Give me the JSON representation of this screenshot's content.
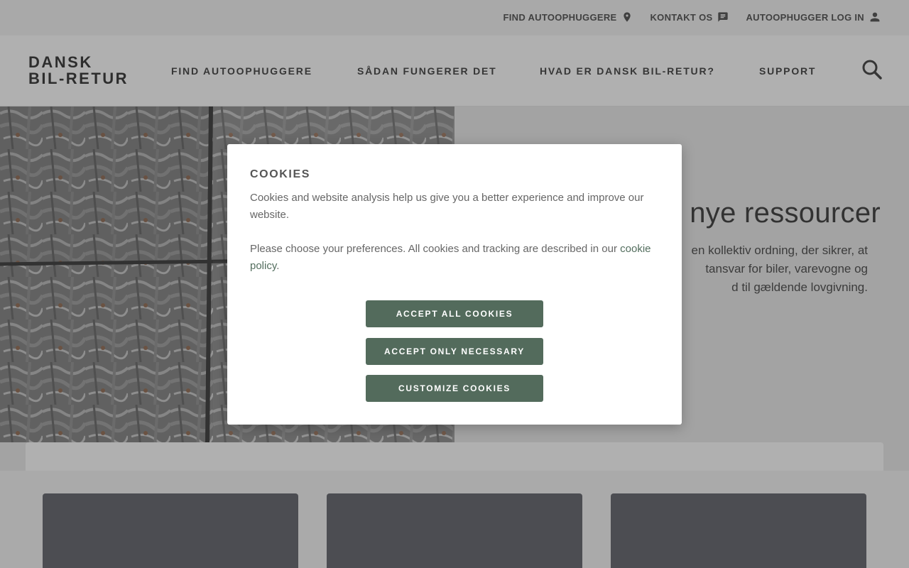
{
  "utility_nav": {
    "find_label": "FIND AUTOOPHUGGERE",
    "contact_label": "KONTAKT OS",
    "login_label": "AUTOOPHUGGER LOG IN"
  },
  "logo": {
    "line1": "DANSK",
    "line2": "BIL-RETUR"
  },
  "main_nav": {
    "items": [
      {
        "label": "FIND AUTOOPHUGGERE"
      },
      {
        "label": "SÅDAN FUNGERER DET"
      },
      {
        "label": "HVAD ER DANSK BIL-RETUR?"
      },
      {
        "label": "SUPPORT"
      }
    ],
    "search_icon": "search-icon"
  },
  "hero": {
    "heading_visible": "nye ressourcer",
    "text_lines": [
      "en kollektiv ordning, der sikrer, at",
      "tansvar for biler, varevogne og",
      "d til gældende lovgivning."
    ]
  },
  "cookie_modal": {
    "title": "COOKIES",
    "intro": "Cookies and website analysis help us give you a better experience and improve our website.",
    "prefs_text": "Please choose your preferences. All cookies and tracking are described in our ",
    "policy_link": "cookie policy",
    "prefs_end": ".",
    "accept_all": "ACCEPT ALL COOKIES",
    "accept_necessary": "ACCEPT ONLY NECESSARY",
    "customize": "CUSTOMIZE COOKIES"
  },
  "colors": {
    "button": "#536b5c",
    "card": "#4a4c55",
    "overlay": "rgba(80,80,80,0.45)"
  }
}
